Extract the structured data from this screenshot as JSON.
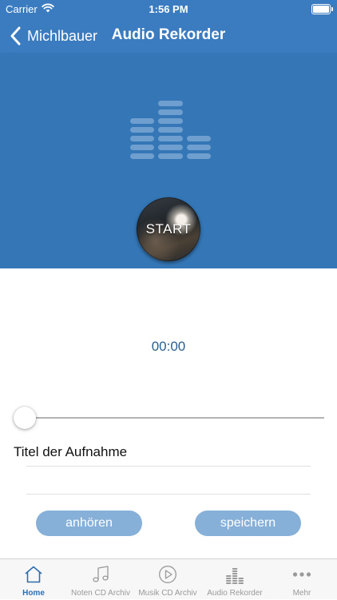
{
  "status_bar": {
    "carrier": "Carrier",
    "time": "1:56 PM",
    "wifi_icon": "wifi-icon",
    "battery_icon": "battery-icon"
  },
  "nav": {
    "back_label": "Michlbauer",
    "title": "Audio Rekorder",
    "back_icon": "chevron-left-icon"
  },
  "colors": {
    "primary": "#3a7cbf",
    "hero_background": "#3476b6",
    "button_background": "#86b0d8",
    "timer_text": "#2a5f8f",
    "tab_active": "#2f6faf",
    "tab_inactive": "#9a9a9a"
  },
  "recorder": {
    "equalizer_icon": "equalizer-icon",
    "start_label": "START",
    "timer": "00:00",
    "slider_progress": 0
  },
  "form": {
    "title_label": "Titel der Aufnahme",
    "title_value": "",
    "title_placeholder": ""
  },
  "actions": {
    "listen_label": "anhören",
    "save_label": "speichern"
  },
  "tabs": [
    {
      "label": "Home",
      "icon": "home-icon",
      "active": true
    },
    {
      "label": "Noten CD Archiv",
      "icon": "music-note-icon",
      "active": false
    },
    {
      "label": "Musik CD Archiv",
      "icon": "play-circle-icon",
      "active": false
    },
    {
      "label": "Audio Rekorder",
      "icon": "equalizer-icon",
      "active": false
    },
    {
      "label": "Mehr",
      "icon": "more-icon",
      "active": false
    }
  ]
}
